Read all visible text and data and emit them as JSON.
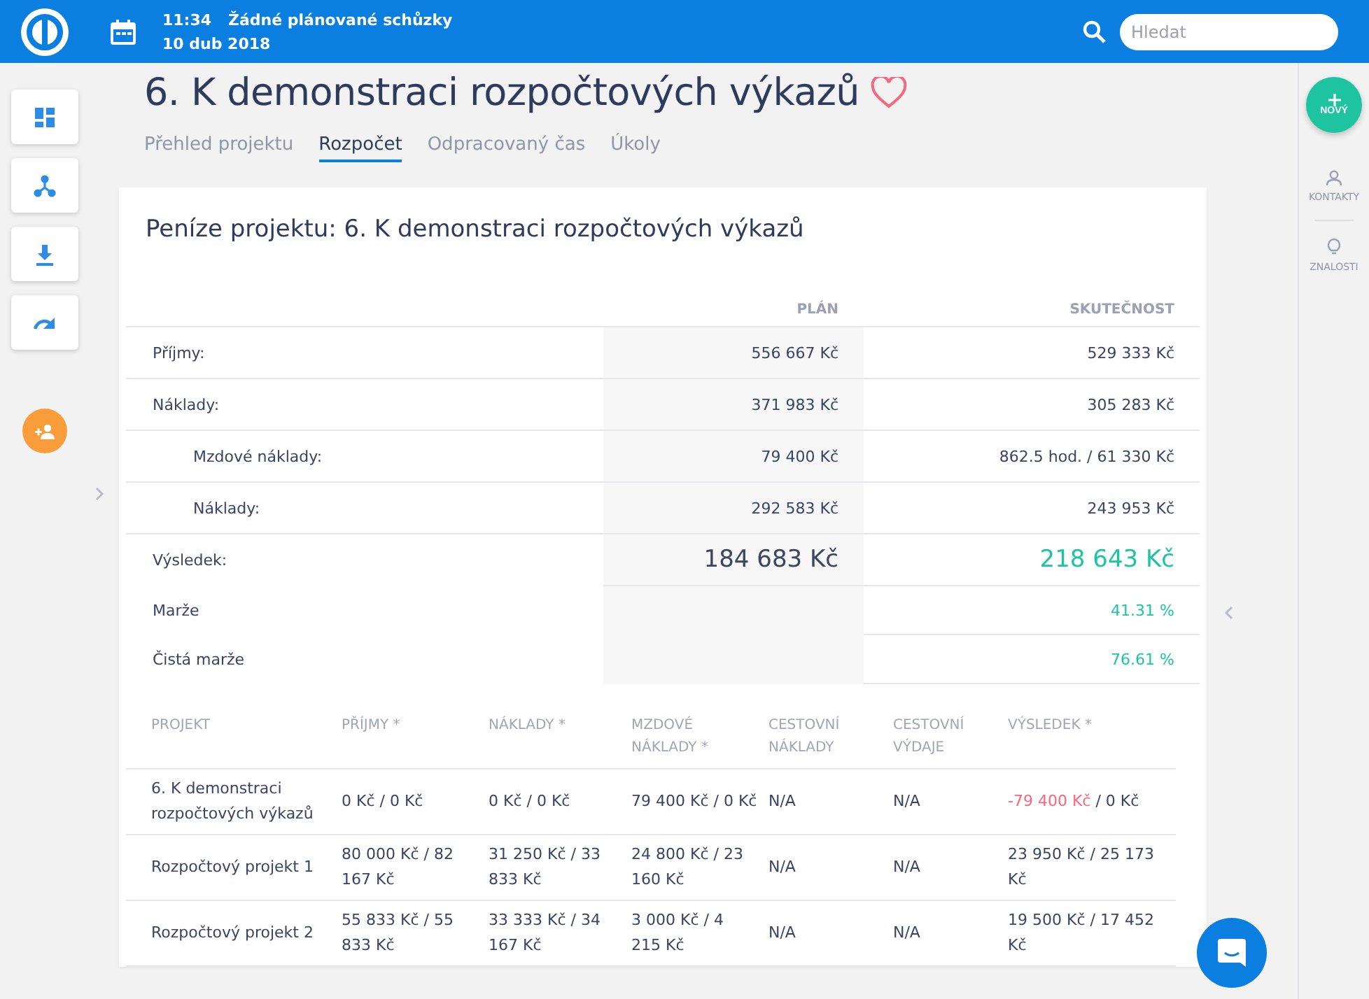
{
  "topbar": {
    "time": "11:34",
    "meeting": "Žádné plánované schůzky",
    "date": "10 dub 2018",
    "search": {
      "placeholder": "Hledat"
    }
  },
  "left_rail": {
    "buttons": [
      {
        "kind": "dashboard"
      },
      {
        "kind": "hierarchy"
      },
      {
        "kind": "download"
      },
      {
        "kind": "redo"
      }
    ]
  },
  "project": {
    "title": "6. K demonstraci rozpočtových výkazů",
    "favorite": false
  },
  "tabs": [
    {
      "label": "Přehled projektu",
      "selected": false
    },
    {
      "label": "Rozpočet",
      "selected": true
    },
    {
      "label": "Odpracovaný čas",
      "selected": false
    },
    {
      "label": "Úkoly",
      "selected": false
    }
  ],
  "card": {
    "title": "Peníze projektu: 6. K demonstraci rozpočtových výkazů",
    "summary": {
      "columns": [
        "PLÁN",
        "SKUTEČNOST"
      ],
      "rows": [
        {
          "kind": "amount",
          "label": "Příjmy:",
          "plan": "556 667 Kč",
          "actual": "529 333 Kč"
        },
        {
          "kind": "amount",
          "label": "Náklady:",
          "plan": "371 983 Kč",
          "actual": "305 283 Kč",
          "children": [
            {
              "kind": "amount",
              "label": "Mzdové náklady:",
              "plan": "79 400 Kč",
              "actual": "862.5 hod. / 61 330 Kč"
            },
            {
              "kind": "amount",
              "label": "Náklady:",
              "plan": "292 583 Kč",
              "actual": "243 953 Kč"
            }
          ]
        },
        {
          "kind": "total",
          "label": "Výsledek:",
          "plan": "184 683 Kč",
          "actual": "218 643 Kč"
        },
        {
          "kind": "percent",
          "label": "Marže",
          "actual": "41.31 %"
        },
        {
          "kind": "percent",
          "label": "Čistá marže",
          "actual": "76.61 %"
        }
      ]
    },
    "projects": {
      "columns": [
        "PROJEKT",
        "PŘÍJMY *",
        "NÁKLADY *",
        "MZDOVÉ NÁKLADY *",
        "CESTOVNÍ NÁKLADY",
        "CESTOVNÍ VÝDAJE",
        "VÝSLEDEK *"
      ],
      "rows": [
        {
          "name": "6. K demonstraci rozpočtových výkazů",
          "income": "0 Kč / 0 Kč",
          "costs": "0 Kč / 0 Kč",
          "wages": "79 400 Kč / 0 Kč",
          "travel_costs": "N/A",
          "travel_expenses": "N/A",
          "result_lead": "-79 400 Kč",
          "result_rest": "/ 0 Kč",
          "negative": true
        },
        {
          "name": "Rozpočtový projekt 1",
          "income": "80 000 Kč / 82 167 Kč",
          "costs": "31 250 Kč / 33 833 Kč",
          "wages": "24 800 Kč / 23 160 Kč",
          "travel_costs": "N/A",
          "travel_expenses": "N/A",
          "result_lead": "23 950 Kč",
          "result_rest": "/ 25 173 Kč",
          "negative": false
        },
        {
          "name": "Rozpočtový projekt 2",
          "income": "55 833 Kč / 55 833 Kč",
          "costs": "33 333 Kč / 34 167 Kč",
          "wages": "3 000 Kč / 4 215 Kč",
          "travel_costs": "N/A",
          "travel_expenses": "N/A",
          "result_lead": "19 500 Kč",
          "result_rest": "/ 17 452 Kč",
          "negative": false
        }
      ]
    }
  },
  "right_rail": {
    "new_button": "NOVÝ",
    "items": [
      {
        "kind": "contacts",
        "label": "KONTAKTY"
      },
      {
        "kind": "knowledge",
        "label": "ZNALOSTI"
      }
    ]
  }
}
